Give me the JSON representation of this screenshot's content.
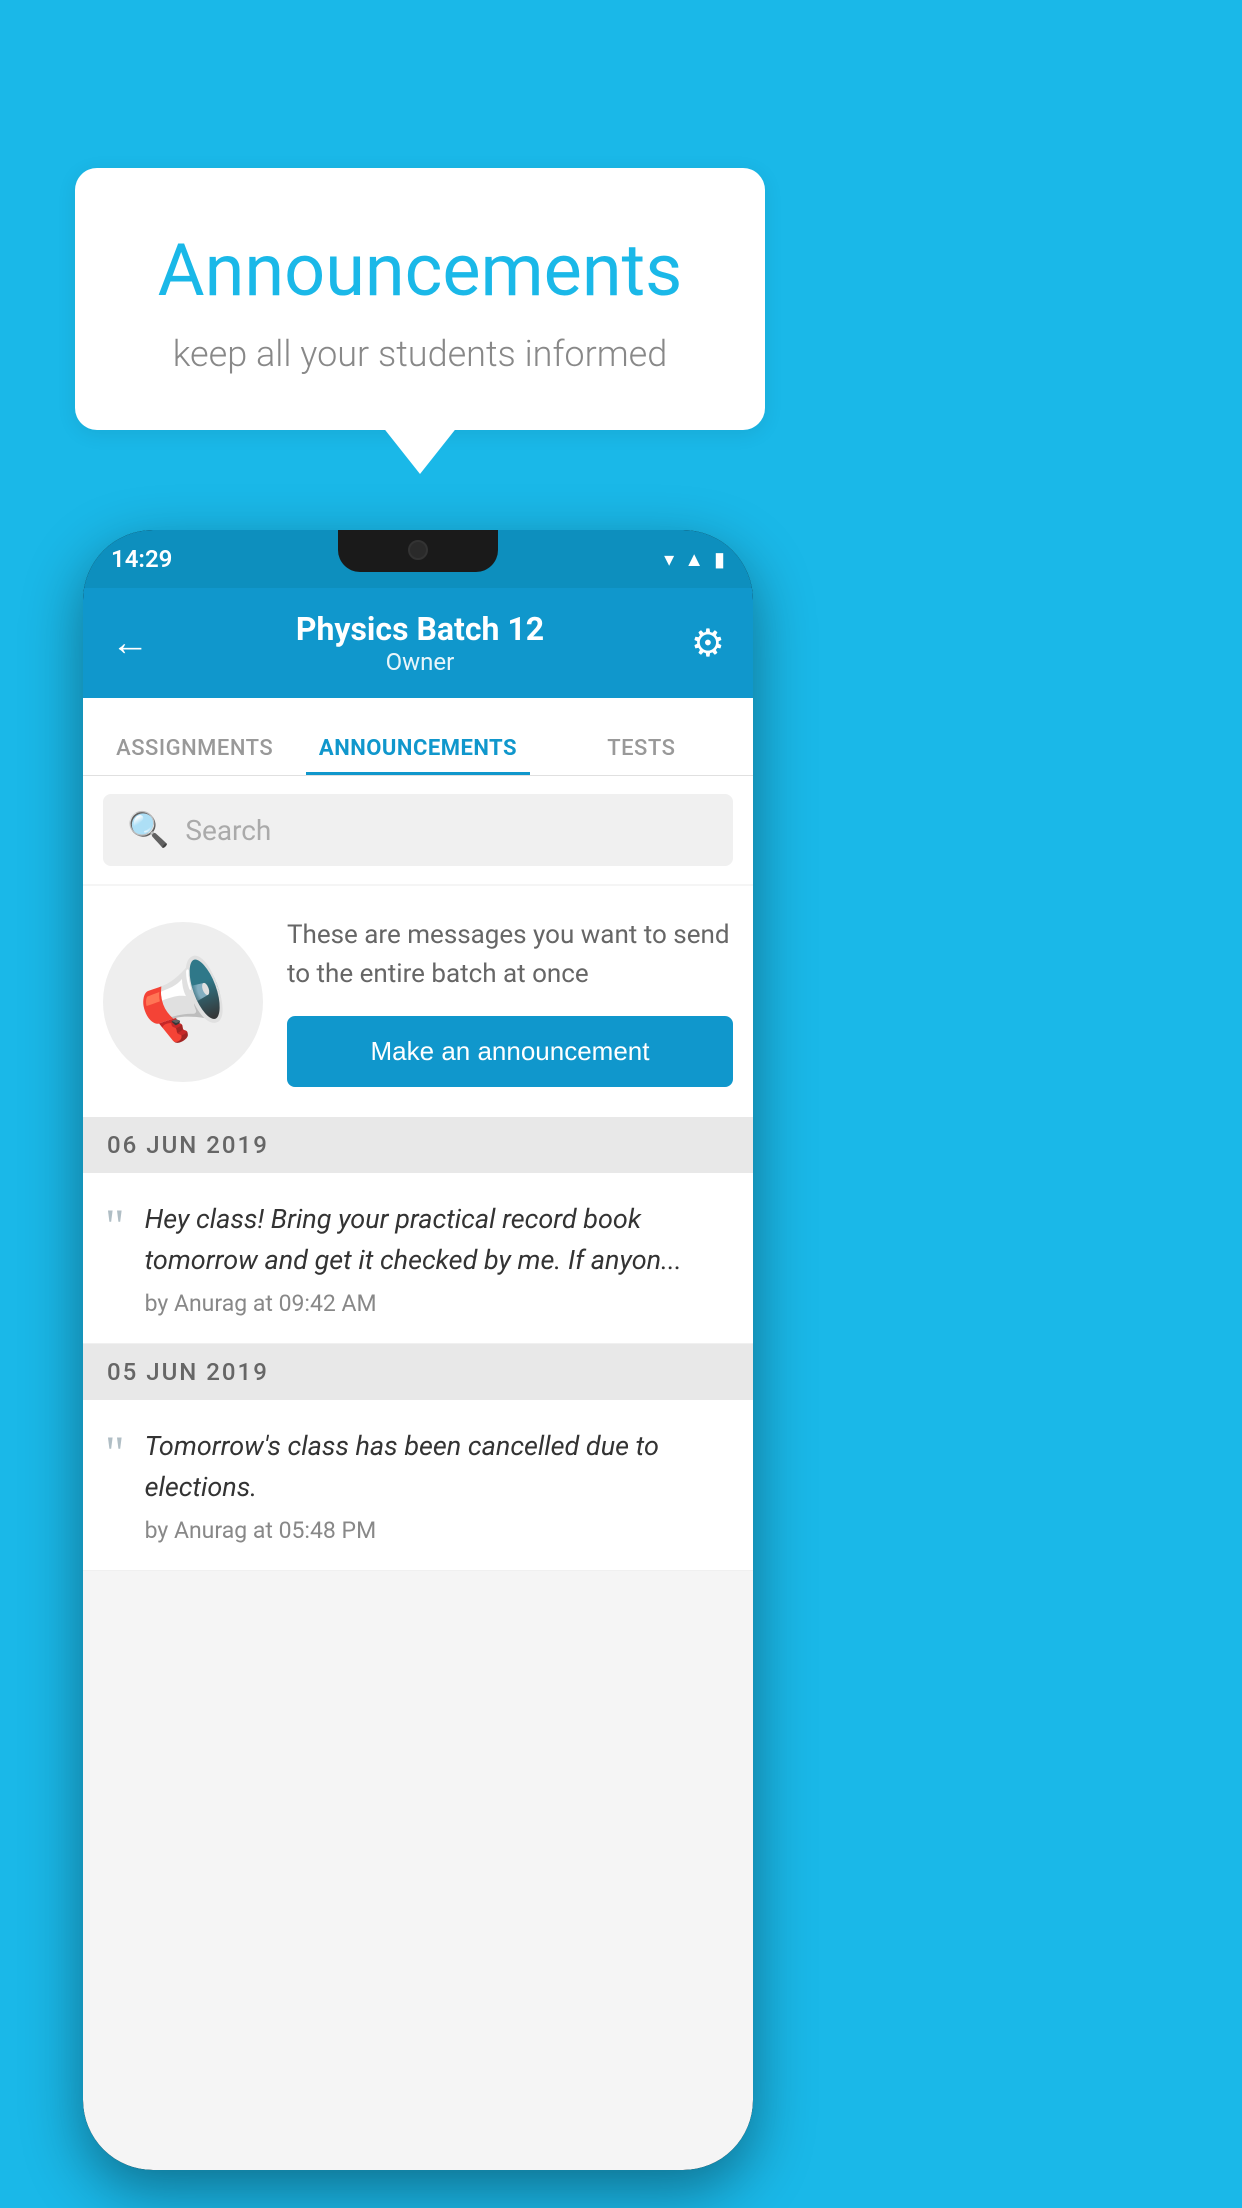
{
  "background_color": "#1ab8e8",
  "speech_bubble": {
    "title": "Announcements",
    "subtitle": "keep all your students informed"
  },
  "status_bar": {
    "time": "14:29",
    "wifi_icon": "▼",
    "signal_icon": "▲",
    "battery_icon": "▮"
  },
  "app_bar": {
    "back_label": "←",
    "title": "Physics Batch 12",
    "subtitle": "Owner",
    "gear_label": "⚙"
  },
  "tabs": [
    {
      "label": "ASSIGNMENTS",
      "active": false
    },
    {
      "label": "ANNOUNCEMENTS",
      "active": true
    },
    {
      "label": "TESTS",
      "active": false
    },
    {
      "label": "...",
      "active": false
    }
  ],
  "search": {
    "placeholder": "Search"
  },
  "promo": {
    "description": "These are messages you want to send to the entire batch at once",
    "button_label": "Make an announcement"
  },
  "announcements": [
    {
      "date": "06  JUN  2019",
      "text": "Hey class! Bring your practical record book tomorrow and get it checked by me. If anyon...",
      "meta": "by Anurag at 09:42 AM"
    },
    {
      "date": "05  JUN  2019",
      "text": "Tomorrow's class has been cancelled due to elections.",
      "meta": "by Anurag at 05:48 PM"
    }
  ]
}
